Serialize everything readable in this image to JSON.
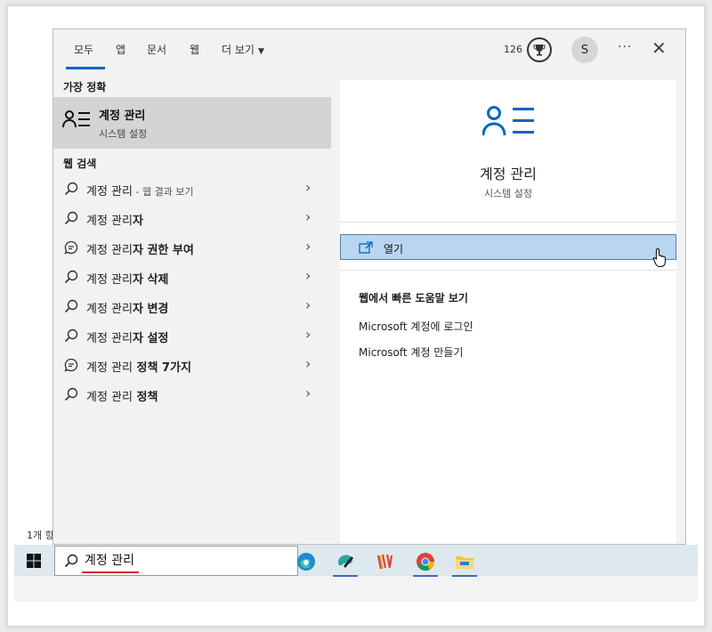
{
  "tabs": [
    {
      "label": "모두"
    },
    {
      "label": "앱"
    },
    {
      "label": "문서"
    },
    {
      "label": "웹"
    },
    {
      "label": "더 보기"
    }
  ],
  "header": {
    "points": "126",
    "avatar_initial": "S"
  },
  "best_match": {
    "section_label": "가장 정확",
    "title": "계정 관리",
    "subtitle": "시스템 설정"
  },
  "web_search": {
    "section_label": "웹 검색",
    "items": [
      {
        "bold": "",
        "normal": "계정 관리",
        "sub": " - 웹 결과 보기",
        "icon": "search-icon"
      },
      {
        "bold": "자",
        "normal": "계정 관리",
        "sub": "",
        "icon": "search-icon"
      },
      {
        "bold": "자 권한 부여",
        "normal": "계정 관리",
        "sub": "",
        "icon": "chat-search-icon"
      },
      {
        "bold": "자 삭제",
        "normal": "계정 관리",
        "sub": "",
        "icon": "search-icon"
      },
      {
        "bold": "자 변경",
        "normal": "계정 관리",
        "sub": "",
        "icon": "search-icon"
      },
      {
        "bold": "자 설정",
        "normal": "계정 관리",
        "sub": "",
        "icon": "search-icon"
      },
      {
        "bold": " 정책 7가지",
        "normal": "계정 관리",
        "sub": "",
        "icon": "chat-search-icon"
      },
      {
        "bold": " 정책",
        "normal": "계정 관리",
        "sub": "",
        "icon": "search-icon"
      }
    ]
  },
  "detail": {
    "title": "계정 관리",
    "subtitle": "시스템 설정",
    "open_label": "열기",
    "help_title": "웹에서 빠른 도움말 보기",
    "help_links": [
      "Microsoft 계정에 로그인",
      "Microsoft 계정 만들기"
    ]
  },
  "taskbar": {
    "search_value": "계정 관리"
  },
  "background": {
    "partial_text": "1개 항"
  },
  "colors": {
    "accent": "#0067c0",
    "selected_bg": "#d4d4d4",
    "open_button_bg": "#b9d6f0"
  }
}
